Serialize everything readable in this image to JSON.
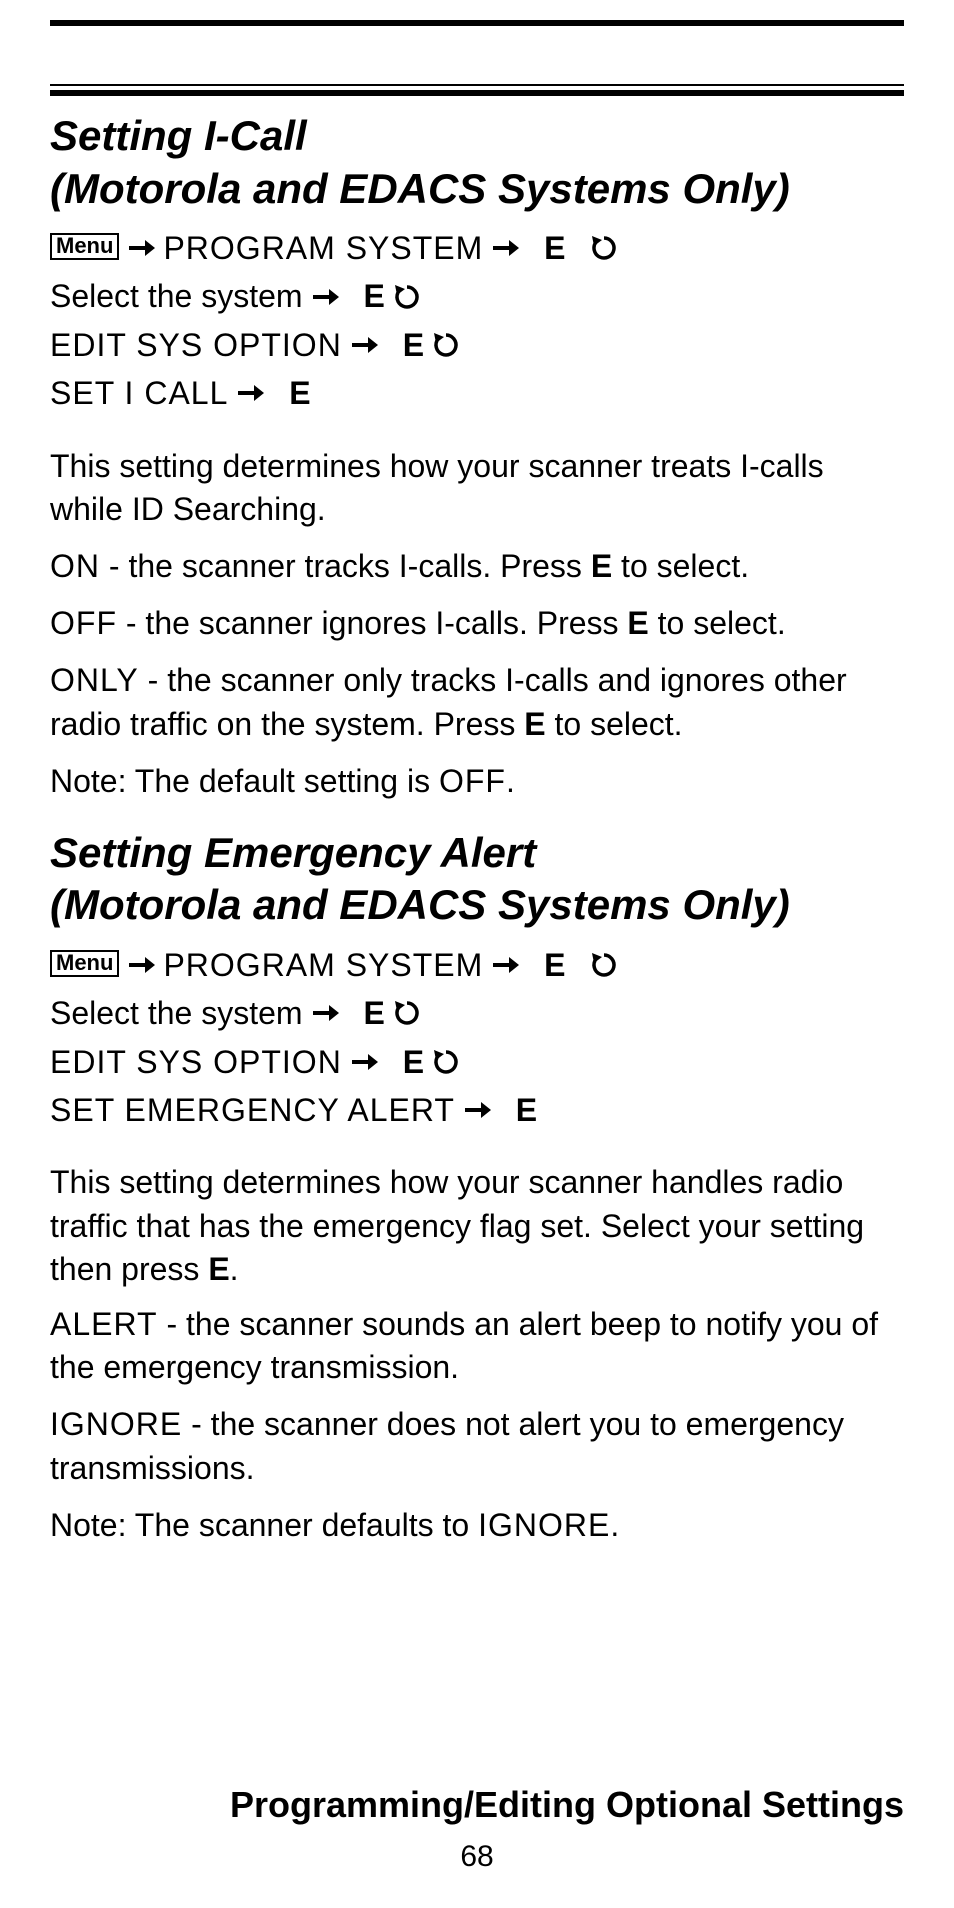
{
  "glyphs": {
    "menu": "Menu",
    "e_key": "E"
  },
  "nav_common": {
    "program_system": "PROGRAM SYSTEM",
    "select_system": "Select the system",
    "edit_sys_option": "EDIT SYS OPTION"
  },
  "section1": {
    "title_l1": "Setting I-Call",
    "title_l2": "(Motorola and EDACS Systems Only)",
    "nav_last": "SET I CALL",
    "intro": "This setting determines how your scanner treats I-calls while ID Searching.",
    "opts": {
      "on_label": "ON",
      "on_text": " - the scanner tracks I-calls. Press ",
      "on_text2": " to select.",
      "off_label": "OFF",
      "off_text": " - the scanner ignores I-calls. Press ",
      "off_text2": " to select.",
      "only_label": "ONLY",
      "only_text": " - the scanner only tracks I-calls and ignores other radio traffic on the system. Press ",
      "only_text2": " to select."
    },
    "note_pre": "Note: The default setting is ",
    "note_val": "OFF",
    "note_post": "."
  },
  "section2": {
    "title_l1": "Setting Emergency Alert",
    "title_l2": "(Motorola and EDACS Systems Only)",
    "nav_last": "SET EMERGENCY ALERT",
    "intro_a": "This setting determines how your scanner handles radio traffic that has the emergency flag set. Select your setting then press ",
    "intro_b": ".",
    "opts": {
      "alert_label": "ALERT",
      "alert_text": " - the scanner sounds an alert beep to notify you of the emergency transmission.",
      "ignore_label": "IGNORE",
      "ignore_text": " - the scanner does not alert you to emergency transmissions."
    },
    "note_pre": "Note: The scanner defaults to ",
    "note_val": "IGNORE",
    "note_post": "."
  },
  "footer": {
    "title": "Programming/Editing Optional Settings",
    "page": "68"
  }
}
